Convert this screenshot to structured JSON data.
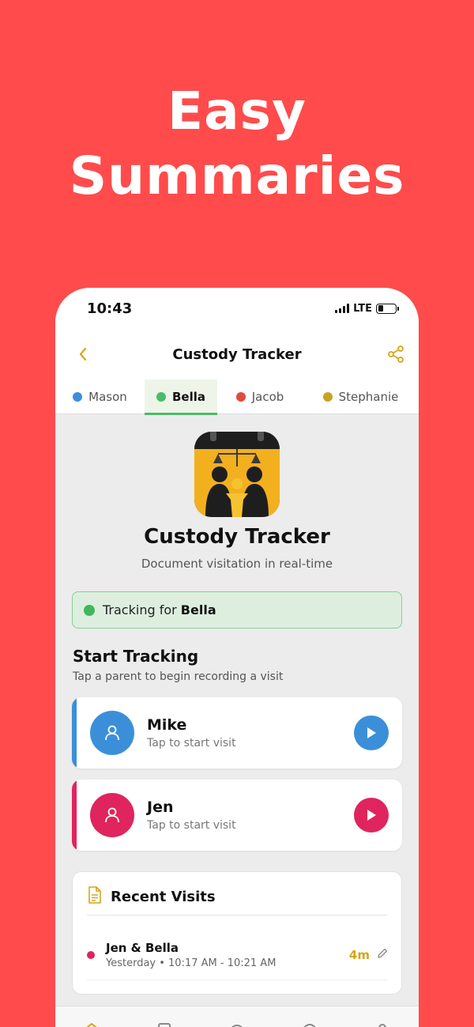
{
  "promo": {
    "line1": "Easy",
    "line2": "Summaries"
  },
  "status_bar": {
    "time": "10:43",
    "network": "LTE"
  },
  "nav": {
    "title": "Custody Tracker",
    "back_icon": "chevron-left-icon",
    "share_icon": "share-icon"
  },
  "tabs": [
    {
      "label": "Mason",
      "color": "#3B8FD9",
      "active": false
    },
    {
      "label": "Bella",
      "color": "#4CBB6A",
      "active": true
    },
    {
      "label": "Jacob",
      "color": "#E04B3E",
      "active": false
    },
    {
      "label": "Stephanie",
      "color": "#C9A227",
      "active": false
    }
  ],
  "app": {
    "name": "Custody Tracker",
    "tagline": "Document visitation in real-time"
  },
  "tracking": {
    "prefix": "Tracking for",
    "child": "Bella"
  },
  "start_tracking": {
    "title": "Start Tracking",
    "subtitle": "Tap a parent to begin recording a visit"
  },
  "parents": [
    {
      "name": "Mike",
      "hint": "Tap to start visit",
      "color": "#3B8FD9"
    },
    {
      "name": "Jen",
      "hint": "Tap to start visit",
      "color": "#E0245E"
    }
  ],
  "recent": {
    "title": "Recent Visits",
    "visits": [
      {
        "name": "Jen & Bella",
        "time": "Yesterday • 10:17 AM - 10:21 AM",
        "duration": "4m"
      }
    ]
  },
  "colors": {
    "background": "#FF4B4B",
    "accent": "#D9A418"
  }
}
